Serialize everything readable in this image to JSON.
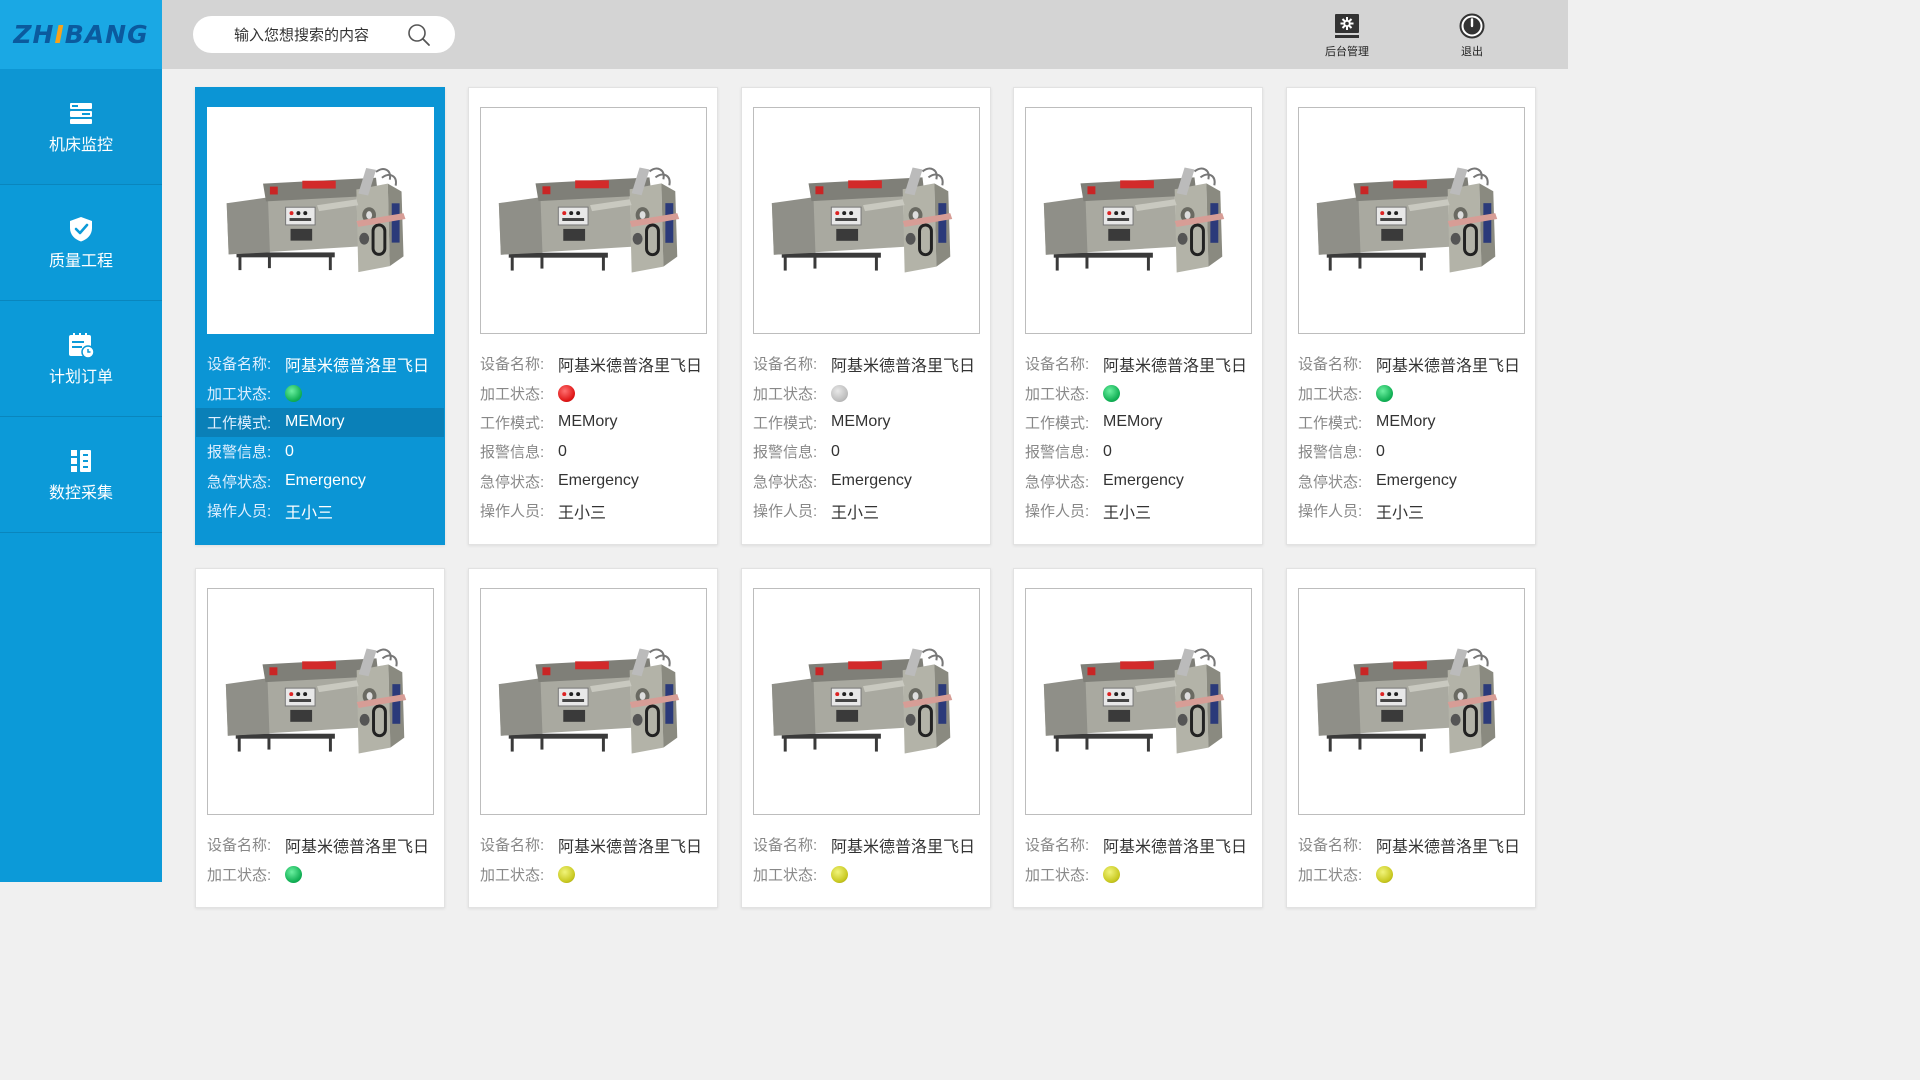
{
  "logo": {
    "part1": "ZH",
    "accent": "I",
    "part2": "BANG"
  },
  "sidebar": {
    "items": [
      {
        "label": "机床监控",
        "icon": "machine-monitor-icon"
      },
      {
        "label": "质量工程",
        "icon": "shield-check-icon"
      },
      {
        "label": "计划订单",
        "icon": "calendar-clock-icon"
      },
      {
        "label": "数控采集",
        "icon": "cnc-collect-icon"
      }
    ]
  },
  "search": {
    "placeholder": "输入您想搜索的内容",
    "icon": "search-icon"
  },
  "header": {
    "admin_label": "后台管理",
    "logout_label": "退出"
  },
  "field_labels": {
    "name": "设备名称:",
    "status": "加工状态:",
    "mode": "工作模式:",
    "alarm": "报警信息:",
    "estop": "急停状态:",
    "operator": "操作人员:"
  },
  "status_colors": {
    "green": "#12b055",
    "red": "#e01818",
    "gray": "#bdbdbd",
    "yellow": "#c8c820"
  },
  "machines": [
    {
      "name": "阿基米德普洛里飞日",
      "status": "green",
      "mode": "MEMory",
      "alarm": "0",
      "estop": "Emergency",
      "operator": "王小三",
      "selected": true
    },
    {
      "name": "阿基米德普洛里飞日",
      "status": "red",
      "mode": "MEMory",
      "alarm": "0",
      "estop": "Emergency",
      "operator": "王小三"
    },
    {
      "name": "阿基米德普洛里飞日",
      "status": "gray",
      "mode": "MEMory",
      "alarm": "0",
      "estop": "Emergency",
      "operator": "王小三"
    },
    {
      "name": "阿基米德普洛里飞日",
      "status": "green",
      "mode": "MEMory",
      "alarm": "0",
      "estop": "Emergency",
      "operator": "王小三"
    },
    {
      "name": "阿基米德普洛里飞日",
      "status": "green",
      "mode": "MEMory",
      "alarm": "0",
      "estop": "Emergency",
      "operator": "王小三"
    },
    {
      "name": "阿基米德普洛里飞日",
      "status": "green"
    },
    {
      "name": "阿基米德普洛里飞日",
      "status": "yellow"
    },
    {
      "name": "阿基米德普洛里飞日",
      "status": "yellow"
    },
    {
      "name": "阿基米德普洛里飞日",
      "status": "yellow"
    },
    {
      "name": "阿基米德普洛里飞日",
      "status": "yellow"
    }
  ]
}
